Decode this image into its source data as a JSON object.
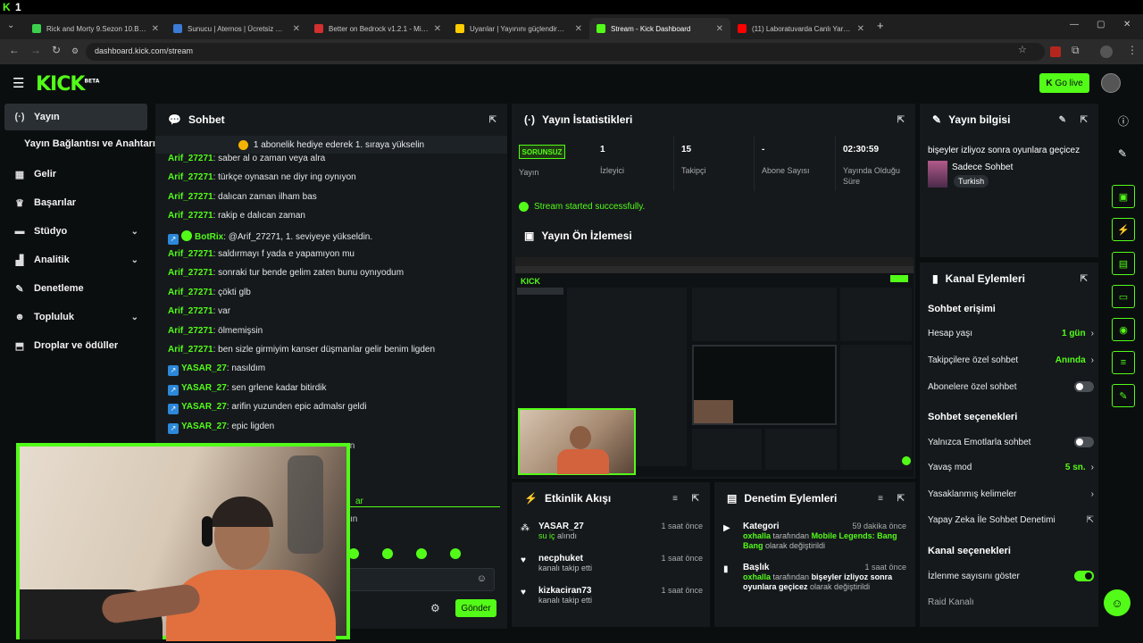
{
  "os": {
    "label_k": "K",
    "label_n": "1"
  },
  "browser": {
    "tabs": [
      {
        "label": "Rick and Morty 9.Sezon 10.Bölüm",
        "color": "#3ccf4e"
      },
      {
        "label": "Sunucu | Aternos | Ücretsiz Minecraft",
        "color": "#3a7bd5"
      },
      {
        "label": "Better on Bedrock v1.2.1 - Minecraft",
        "color": "#d32f2f"
      },
      {
        "label": "Uyarılar | Yayınını güçlendirmek",
        "color": "#ffcc00"
      },
      {
        "label": "Stream - Kick Dashboard",
        "color": "#53fc18"
      },
      {
        "label": "(11) Laboratuvarda Canlı Yaratık",
        "color": "#ff0000"
      }
    ],
    "new_tab": "+",
    "url": "dashboard.kick.com/stream"
  },
  "header": {
    "logo": "KICK",
    "logo_sup": "BETA",
    "go_live": "Go live"
  },
  "sidebar": {
    "items": [
      {
        "label": "Yayın",
        "icon": "(·)"
      },
      {
        "label": "Yayın Bağlantısı ve Anahtarı",
        "icon": ""
      },
      {
        "label": "Gelir",
        "icon": "▦"
      },
      {
        "label": "Başarılar",
        "icon": "♛"
      },
      {
        "label": "Stüdyo",
        "icon": "▬"
      },
      {
        "label": "Analitik",
        "icon": "▟"
      },
      {
        "label": "Denetleme",
        "icon": "✎"
      },
      {
        "label": "Topluluk",
        "icon": "☻"
      },
      {
        "label": "Droplar ve ödüller",
        "icon": "⬒"
      }
    ],
    "chevron": "⌄"
  },
  "chat": {
    "title": "Sohbet",
    "pinned": "1 abonelik hediye ederek 1. sıraya yükselin",
    "messages": [
      {
        "user": "Arif_27271",
        "text": ": saber al o zaman veya alra"
      },
      {
        "user": "Arif_27271",
        "text": ": türkçe oynasan ne diyr ing oynıyon"
      },
      {
        "user": "Arif_27271",
        "text": ": dalıcan zaman ilham bas"
      },
      {
        "user": "Arif_27271",
        "text": ": rakip e dalıcan zaman"
      },
      {
        "user": "BotRix",
        "text": ": @Arif_27271, 1. seviyeye yükseldin."
      },
      {
        "user": "Arif_27271",
        "text": ": saldırmayı f yada e yapamıyon mu"
      },
      {
        "user": "Arif_27271",
        "text": ": sonraki tur bende gelim zaten bunu oynıyodum"
      },
      {
        "user": "Arif_27271",
        "text": ": çökti glb"
      },
      {
        "user": "Arif_27271",
        "text": ": var"
      },
      {
        "user": "Arif_27271",
        "text": ": ölmemişsin"
      },
      {
        "user": "Arif_27271",
        "text": ": ben sizle girmiyim kanser düşmanlar gelir benim ligden"
      },
      {
        "user": "YASAR_27",
        "text": ": nasıldım"
      },
      {
        "user": "YASAR_27",
        "text": ": sen grlene kadar bitirdik"
      },
      {
        "user": "YASAR_27",
        "text": ": arifin yuzunden epic admalsr geldi"
      },
      {
        "user": "YASAR_27",
        "text": ": epic ligden"
      }
    ],
    "send": "Gönder",
    "partial_a": "ar",
    "partial_b": "zın",
    "partial_c": "ın"
  },
  "stats": {
    "title": "Yayın İstatistikleri",
    "status_badge": "SORUNSUZ",
    "items": [
      {
        "value": "",
        "label": "Yayın"
      },
      {
        "value": "1",
        "label": "İzleyici"
      },
      {
        "value": "15",
        "label": "Takipçi"
      },
      {
        "value": "-",
        "label": "Abone Sayısı"
      },
      {
        "value": "02:30:59",
        "label": "Yayında Olduğu Süre"
      }
    ],
    "success": "Stream started successfully."
  },
  "preview": {
    "title": "Yayın Ön İzlemesi"
  },
  "stream_info": {
    "title": "Yayın bilgisi",
    "stream_title": "bişeyler izliyoz sonra oyunlara geçicez",
    "category": "Sadece Sohbet",
    "tag": "Turkish"
  },
  "channel_actions": {
    "title": "Kanal Eylemleri",
    "section_access": "Sohbet erişimi",
    "hesap_yasi": "Hesap yaşı",
    "hesap_yasi_val": "1 gün",
    "followers_only": "Takipçilere özel sohbet",
    "followers_only_val": "Anında",
    "subs_only": "Abonelere özel sohbet",
    "section_chat": "Sohbet seçenekleri",
    "emotes_only": "Yalnızca Emotlarla sohbet",
    "slow_mode": "Yavaş mod",
    "slow_mode_val": "5 sn.",
    "banned_words": "Yasaklanmış kelimeler",
    "ai_moderation": "Yapay Zeka İle Sohbet Denetimi",
    "section_channel": "Kanal seçenekleri",
    "show_viewers": "İzlenme sayısını göster",
    "raid": "Raid Kanalı"
  },
  "activity": {
    "title": "Etkinlik Akışı",
    "items": [
      {
        "user": "YASAR_27",
        "action": "su iç",
        "action_rest": " alındı",
        "time": "1 saat önce"
      },
      {
        "user": "necphuket",
        "action": "",
        "action_rest": "kanalı takip etti",
        "time": "1 saat önce"
      },
      {
        "user": "kizkaciran73",
        "action": "",
        "action_rest": "kanalı takip etti",
        "time": "1 saat önce"
      }
    ]
  },
  "moderation": {
    "title": "Denetim Eylemleri",
    "items": [
      {
        "kind": "Kategori",
        "time": "59 dakika önce",
        "who": "oxhalla",
        "mid": " tarafından ",
        "target": "Mobile Legends: Bang Bang",
        "tail": " olarak değiştirildi"
      },
      {
        "kind": "Başlık",
        "time": "1 saat önce",
        "who": "oxhalla",
        "mid": " tarafından ",
        "target": "bişeyler izliyoz sonra oyunlara geçicez",
        "tail": " olarak değiştirildi"
      }
    ]
  },
  "colors": {
    "accent": "#53fc18",
    "bg": "#0b0e0f",
    "panel": "#15191c"
  }
}
